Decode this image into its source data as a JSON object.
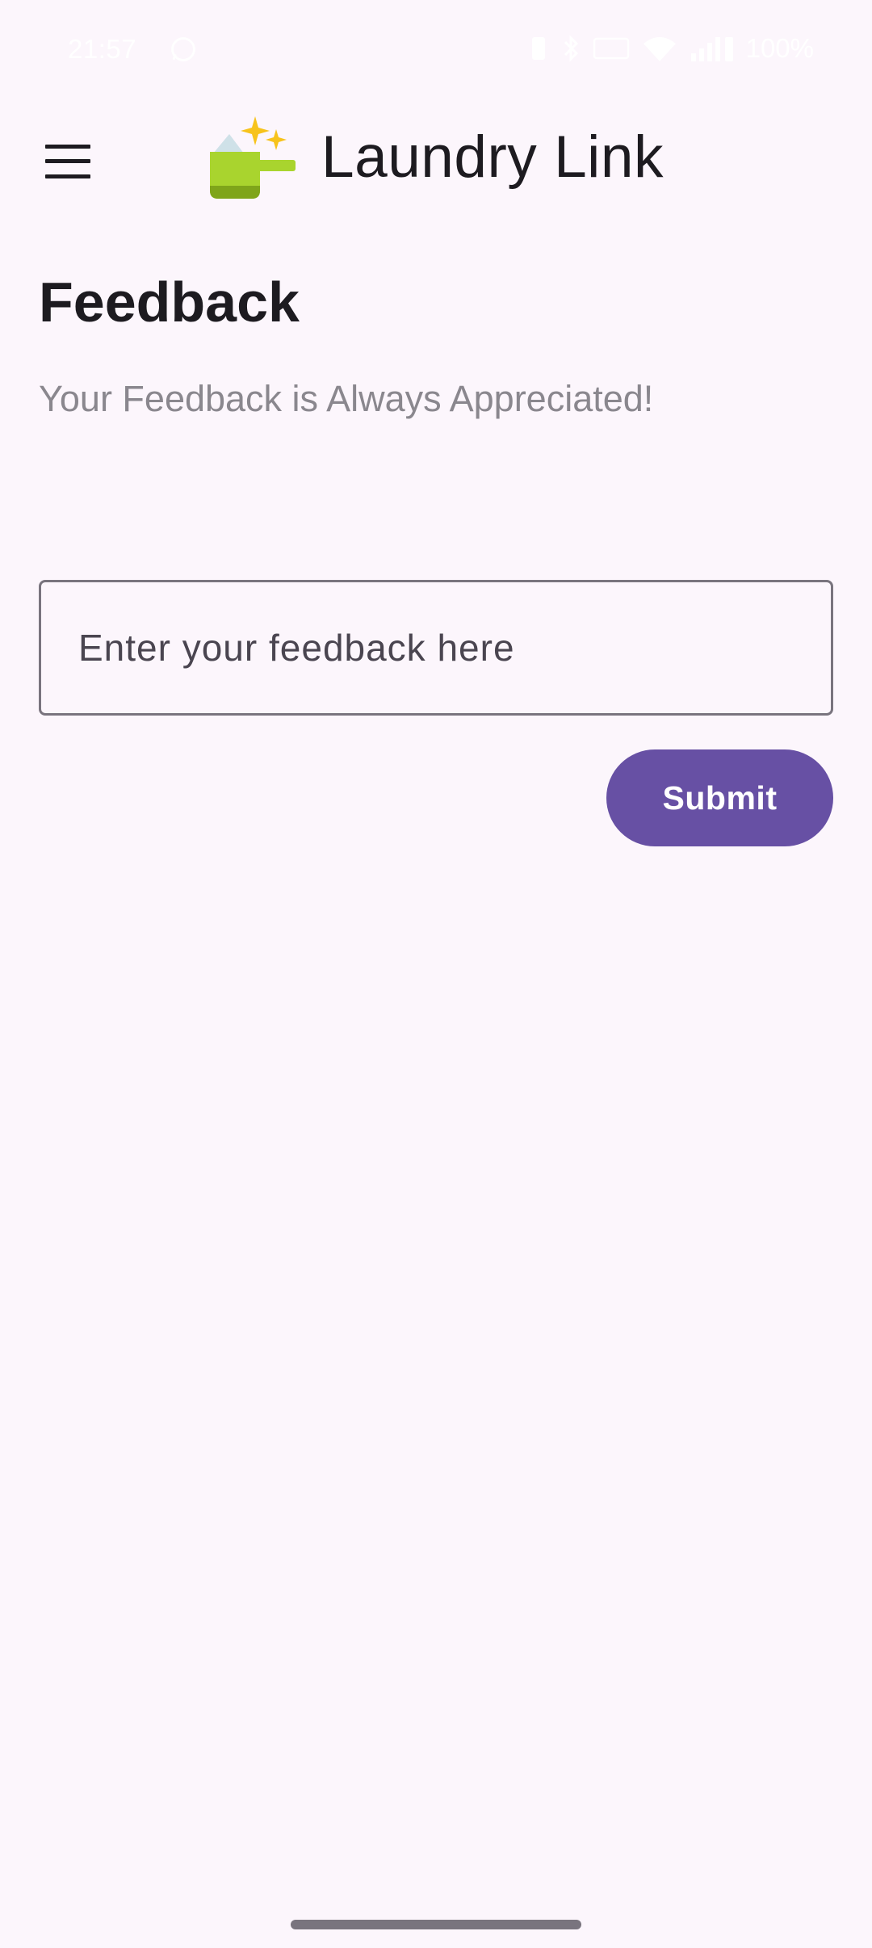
{
  "status_bar": {
    "time": "21:57",
    "battery": "100%"
  },
  "app_bar": {
    "title": "Laundry Link",
    "menu_icon": "hamburger-menu-icon",
    "logo_icon": "detergent-scoop-sparkles-icon"
  },
  "page": {
    "title": "Feedback",
    "subtitle": "Your Feedback is Always Appreciated!"
  },
  "feedback_form": {
    "input_value": "",
    "input_placeholder": "Enter your feedback here",
    "submit_label": "Submit"
  },
  "colors": {
    "background": "#FCF6FC",
    "primary": "#6750A4",
    "on_surface": "#1D1B20",
    "subtitle": "#8A878E",
    "outline": "#79747E"
  }
}
